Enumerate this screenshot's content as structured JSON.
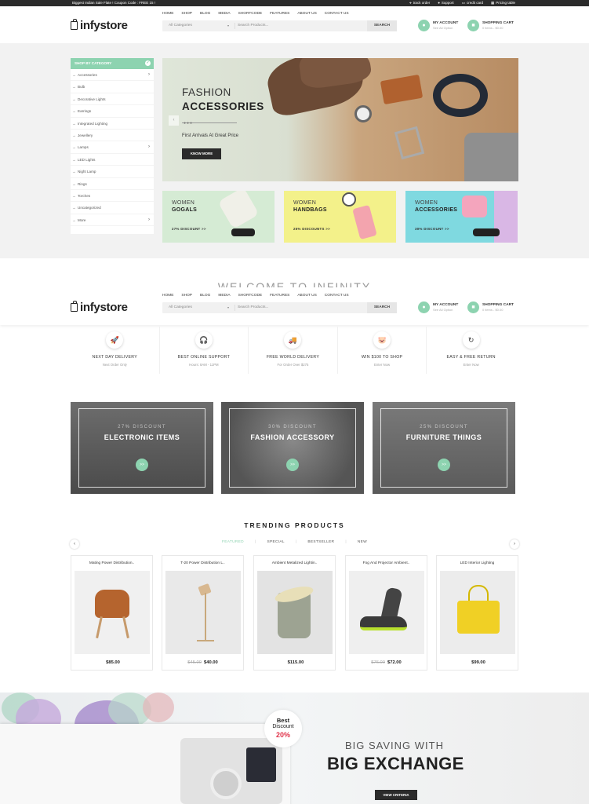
{
  "topbar": {
    "promo": "Biggest Indian Sale Flate ! Coupon Code : FREE 15 !",
    "links": [
      "track order",
      "Support",
      "credit card",
      "Pricing table"
    ]
  },
  "header": {
    "logo": "infystore",
    "nav": [
      "HOME",
      "SHOP",
      "BLOG",
      "MEDIA",
      "SHORTCODE",
      "FEATURES",
      "ABOUT US",
      "CONTACT US"
    ],
    "search": {
      "category": "All Categories",
      "placeholder": "Search Products...",
      "button": "SEARCH"
    },
    "account": {
      "title": "MY ACCOUNT",
      "sub": "See All Option"
    },
    "cart": {
      "title": "SHOPPING CART",
      "sub": "0 items - $0.00"
    }
  },
  "sidebar": {
    "title": "SHOP BY CATEGORY",
    "items": [
      {
        "label": "Accessories",
        "more": true
      },
      {
        "label": "Bulb",
        "more": false
      },
      {
        "label": "Decorative Lights",
        "more": false
      },
      {
        "label": "Earrings",
        "more": false
      },
      {
        "label": "Integrated Lighting",
        "more": false
      },
      {
        "label": "Jewellery",
        "more": false
      },
      {
        "label": "Lamps",
        "more": true
      },
      {
        "label": "LED Lights",
        "more": false
      },
      {
        "label": "Night Lamp",
        "more": false
      },
      {
        "label": "Rings",
        "more": false
      },
      {
        "label": "Torches",
        "more": false
      },
      {
        "label": "Uncategorized",
        "more": false
      },
      {
        "label": "More",
        "more": true
      }
    ]
  },
  "hero": {
    "title1": "FASHION",
    "title2": "ACCESSORIES",
    "subtitle": "First Arrivals At Great Price",
    "button": "KNOW MORE"
  },
  "promos": [
    {
      "l1": "WOMEN",
      "l2": "GOGALS",
      "l3": "27% DISCOUNT >>",
      "bg": "#d5ebd4"
    },
    {
      "l1": "WOMEN",
      "l2": "HANDBAGS",
      "l3": "25% DISCOUNTS >>",
      "bg": "#f3f18a"
    },
    {
      "l1": "WOMEN",
      "l2": "ACCESSORIES",
      "l3": "30% DISCOUNT >>",
      "bg": "#7fd9e0"
    }
  ],
  "welcome": "WELCOME TO INFINITY",
  "features": [
    {
      "icon": "rocket-icon",
      "glyph": "🚀",
      "title": "NEXT DAY DELIVERY",
      "sub": "Next Order Only"
    },
    {
      "icon": "headset-icon",
      "glyph": "🎧",
      "title": "BEST ONLINE SUPPORT",
      "sub": "Hours: 8AM - 11PM"
    },
    {
      "icon": "truck-icon",
      "glyph": "🚚",
      "title": "FREE WORLD DELIVERY",
      "sub": "For Order Over $275"
    },
    {
      "icon": "piggy-bank-icon",
      "glyph": "🐷",
      "title": "WIN $100 TO SHOP",
      "sub": "Enter Now"
    },
    {
      "icon": "return-icon",
      "glyph": "↻",
      "title": "EASY & FREE RETURN",
      "sub": "Enter Now"
    }
  ],
  "categories": [
    {
      "discount": "27% DISCOUNT",
      "name": "ELECTRONIC ITEMS",
      "go": ">>"
    },
    {
      "discount": "30% DISCOUNT",
      "name": "FASHION ACCESSORY",
      "go": ">>"
    },
    {
      "discount": "25% DISCOUNT",
      "name": "FURNITURE THINGS",
      "go": ">>"
    }
  ],
  "trending": {
    "title": "TRENDING PRODUCTS",
    "tabs": [
      "FEATURED",
      "SPECIAL",
      "BESTSELLER",
      "NEW"
    ],
    "active_tab": "FEATURED",
    "products": [
      {
        "name": "Mating Power Distribution..",
        "old": "",
        "price": "$85.00"
      },
      {
        "name": "T-20 Power Distribution L..",
        "old": "$45.00",
        "price": "$40.00"
      },
      {
        "name": "Ambient Metalized Lightin..",
        "old": "",
        "price": "$115.00"
      },
      {
        "name": "Fog And Projector Ambient..",
        "old": "$76.00",
        "price": "$72.00"
      },
      {
        "name": "LED Interior Lighting",
        "old": "",
        "price": "$99.00"
      }
    ]
  },
  "bottom_banner": {
    "badge": {
      "l1": "Best",
      "l2": "Discount",
      "l3": "20%"
    },
    "line1": "BIG SAVING WITH",
    "line2": "BIG EXCHANGE",
    "button": "VIEW CRITERIA"
  },
  "colors": {
    "accent": "#8dd3b0",
    "dark": "#2b2b2b",
    "sale": "#e0344b"
  }
}
